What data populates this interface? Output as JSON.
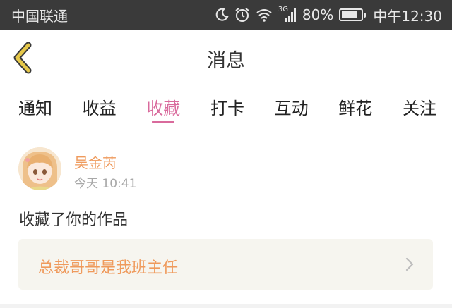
{
  "status_bar": {
    "carrier": "中国联通",
    "network_type": "3G",
    "battery_percent": "80%",
    "battery_level": 0.8,
    "time": "中午12:30",
    "icons": [
      "moon-icon",
      "alarm-icon",
      "wifi-icon",
      "signal-icon",
      "battery-icon"
    ]
  },
  "nav": {
    "title": "消息",
    "back_icon": "chevron-left-icon",
    "accent_color": "#e6c84a"
  },
  "tabs": [
    {
      "label": "通知",
      "active": false
    },
    {
      "label": "收益",
      "active": false
    },
    {
      "label": "收藏",
      "active": true
    },
    {
      "label": "打卡",
      "active": false
    },
    {
      "label": "互动",
      "active": false
    },
    {
      "label": "鲜花",
      "active": false
    },
    {
      "label": "关注",
      "active": false
    }
  ],
  "active_tab_color": "#d96a9c",
  "message": {
    "author": "吴金芮",
    "time": "今天 10:41",
    "text": "收藏了你的作品",
    "work_title": "总裁哥哥是我班主任",
    "link_color": "#ef9a5c"
  }
}
